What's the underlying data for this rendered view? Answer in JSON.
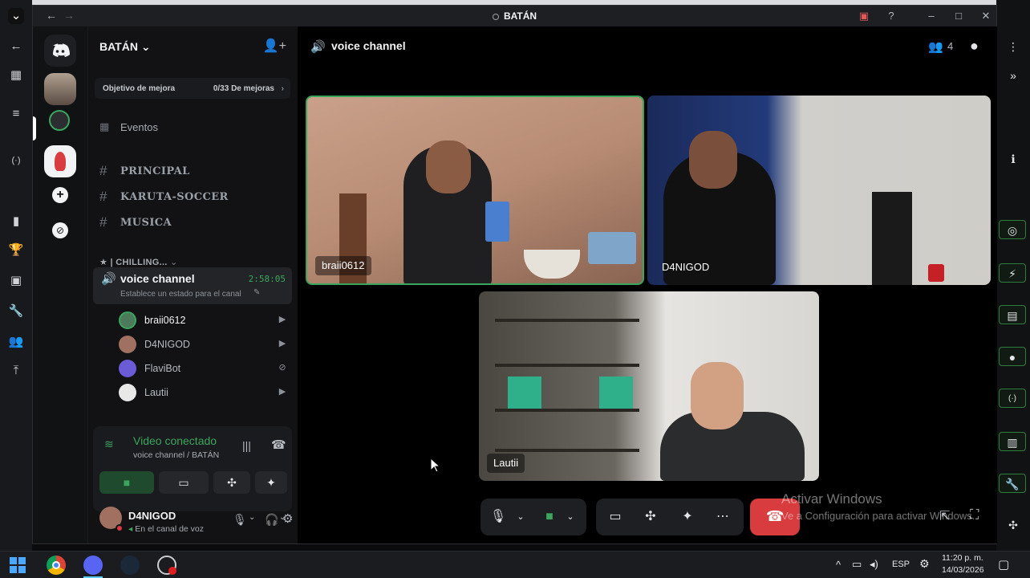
{
  "window": {
    "title": "BATÁN"
  },
  "sidebar": {
    "server_name": "BATÁN",
    "boost_goal_label": "Objetivo de mejora",
    "boost_goal_count": "0/33 De mejoras",
    "events_label": "Eventos",
    "text_channels": [
      "PRINCIPAL",
      "KARUTA-SOCCER",
      "MUSICA"
    ],
    "category_label": "★ | CHILLING...",
    "voice_channel": {
      "name": "voice channel",
      "timer": "2:58:05",
      "status_placeholder": "Establece un estado para el canal"
    },
    "members": [
      {
        "name": "braii0612",
        "color": "#4c7a5a"
      },
      {
        "name": "D4NIGOD",
        "color": "#a07060"
      },
      {
        "name": "FlaviBot",
        "color": "#6b5bd6"
      },
      {
        "name": "Lautii",
        "color": "#e8e8e8"
      }
    ]
  },
  "voice_panel": {
    "status": "Video conectado",
    "location": "voice channel / BATÁN"
  },
  "user_panel": {
    "username": "D4NIGOD",
    "status": "En el canal de voz"
  },
  "main": {
    "channel_title": "voice channel",
    "participant_count": "4",
    "tiles": [
      {
        "name": "braii0612",
        "speaking": true
      },
      {
        "name": "D4NIGOD",
        "speaking": false
      },
      {
        "name": "Lautii",
        "speaking": false
      }
    ]
  },
  "watermark": {
    "line1": "Activar Windows",
    "line2": "Ve a Configuración para activar Windows."
  },
  "taskbar": {
    "language": "ESP",
    "time": "11:20 p. m.",
    "date": "14/03/2026"
  },
  "colors": {
    "accent_green": "#3ba55d",
    "hangup_red": "#d83c3e",
    "blurple": "#5865f2"
  }
}
